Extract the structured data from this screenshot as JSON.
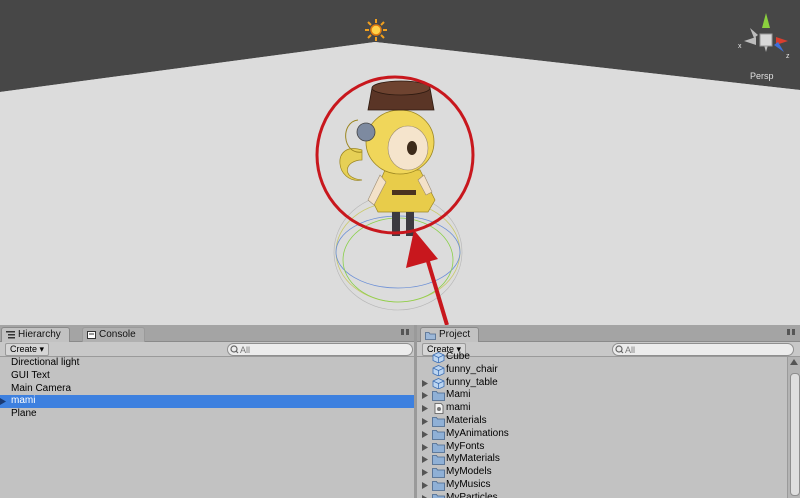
{
  "scene": {
    "projection_label": "Persp",
    "gizmo_axes": {
      "x": "x",
      "z": "z"
    },
    "colors": {
      "sky": "#474747",
      "ground": "#dcdcdc",
      "annotation": "#c8171d"
    }
  },
  "hierarchy": {
    "tab_label": "Hierarchy",
    "console_tab_label": "Console",
    "create_label": "Create",
    "search_placeholder": "All",
    "items": [
      {
        "label": "Directional light"
      },
      {
        "label": "GUI Text"
      },
      {
        "label": "Main Camera"
      },
      {
        "label": "mami",
        "selected": true
      },
      {
        "label": "Plane"
      }
    ]
  },
  "project": {
    "tab_label": "Project",
    "create_label": "Create",
    "search_placeholder": "All",
    "items": [
      {
        "label": "Cube",
        "icon": "prefab-icon",
        "expandable": false
      },
      {
        "label": "funny_chair",
        "icon": "prefab-icon",
        "expandable": false
      },
      {
        "label": "funny_table",
        "icon": "prefab-icon",
        "expandable": true
      },
      {
        "label": "Mami",
        "icon": "folder-icon",
        "expandable": true
      },
      {
        "label": "mami",
        "icon": "file-icon",
        "expandable": true
      },
      {
        "label": "Materials",
        "icon": "folder-icon",
        "expandable": true
      },
      {
        "label": "MyAnimations",
        "icon": "folder-icon",
        "expandable": true
      },
      {
        "label": "MyFonts",
        "icon": "folder-icon",
        "expandable": true
      },
      {
        "label": "MyMaterials",
        "icon": "folder-icon",
        "expandable": true
      },
      {
        "label": "MyModels",
        "icon": "folder-icon",
        "expandable": true
      },
      {
        "label": "MyMusics",
        "icon": "folder-icon",
        "expandable": true
      },
      {
        "label": "MyParticles",
        "icon": "folder-icon",
        "expandable": true
      }
    ]
  }
}
